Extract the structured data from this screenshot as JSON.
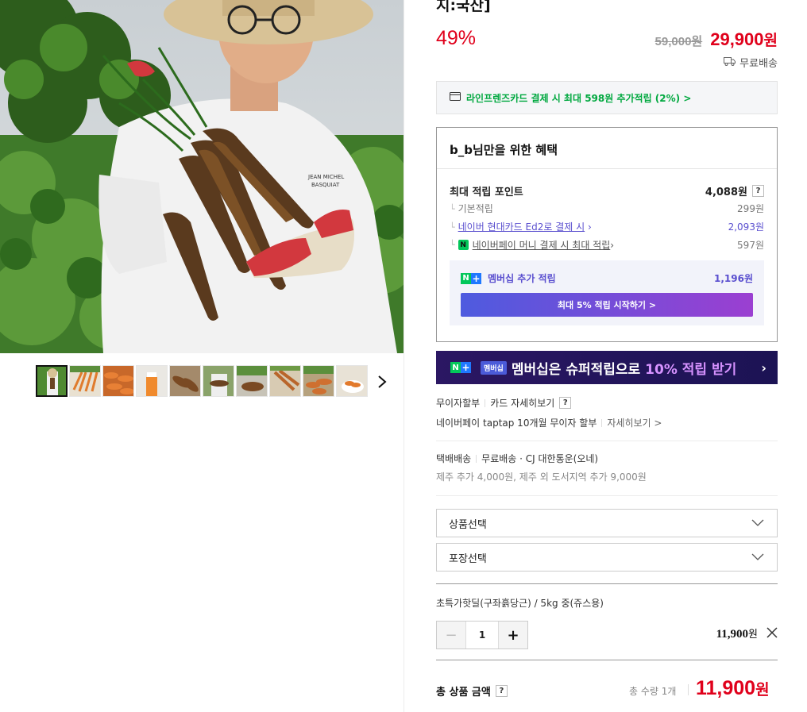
{
  "product": {
    "title_tail": "지:국산]",
    "discount": "49%",
    "original_price": "59,000원",
    "sale_price": "29,900",
    "sale_unit": "원",
    "shipping_badge": "무료배송",
    "thumbnails": [
      "main",
      "carrot-pile",
      "carrots-sorted",
      "carrot-juice",
      "carrots-box",
      "carrots-hand",
      "carrots-soil",
      "carrots-tray",
      "carrots-crate",
      "carrots-bowl"
    ]
  },
  "card_promo": "라인프렌즈카드 결제 시 최대 598원 추가적립 (2%) >",
  "benefit": {
    "title": "b_b님만을 위한 혜택",
    "max_point_label": "최대 적립 포인트",
    "max_point_value": "4,088원",
    "help": "?",
    "rows": [
      {
        "label": "기본적립",
        "value": "299원"
      },
      {
        "label": "네이버 현대카드 Ed2로 결제 시",
        "value": "2,093원"
      },
      {
        "label": "네이버페이 머니 결제 시 최대 적립",
        "value": "597원"
      }
    ],
    "member_label": "멤버십 추가 적립",
    "member_value": "1,196원",
    "member_button": "최대 5% 적립 시작하기 >"
  },
  "banner": {
    "badge": "멤버십",
    "text": "멤버십은 슈퍼적립으로",
    "highlight": "10% 적립 받기"
  },
  "installment": {
    "label": "무이자할부",
    "link": "카드 자세히보기",
    "help": "?",
    "line2": "네이버페이 taptap 10개월 무이자 할부",
    "more": "자세히보기 >"
  },
  "shipping": {
    "label": "택배배송",
    "info": "무료배송 · CJ 대한통운(오네)",
    "extra": "제주 추가 4,000원, 제주 외 도서지역 추가 9,000원"
  },
  "selects": {
    "product": "상품선택",
    "package": "포장선택"
  },
  "option": {
    "name": "초특가핫딜(구좌흙당근) / 5kg 중(쥬스용)",
    "minus": "−",
    "plus": "+",
    "quantity": "1",
    "price": "11,900",
    "price_unit": "원"
  },
  "total": {
    "label": "총 상품 금액",
    "help": "?",
    "qty": "총 수량 1개",
    "price": "11,900",
    "unit": "원"
  },
  "colors": {
    "sale_red": "#e0001b",
    "naver_green": "#03c75a",
    "member_purple": "#5a4fcf"
  }
}
